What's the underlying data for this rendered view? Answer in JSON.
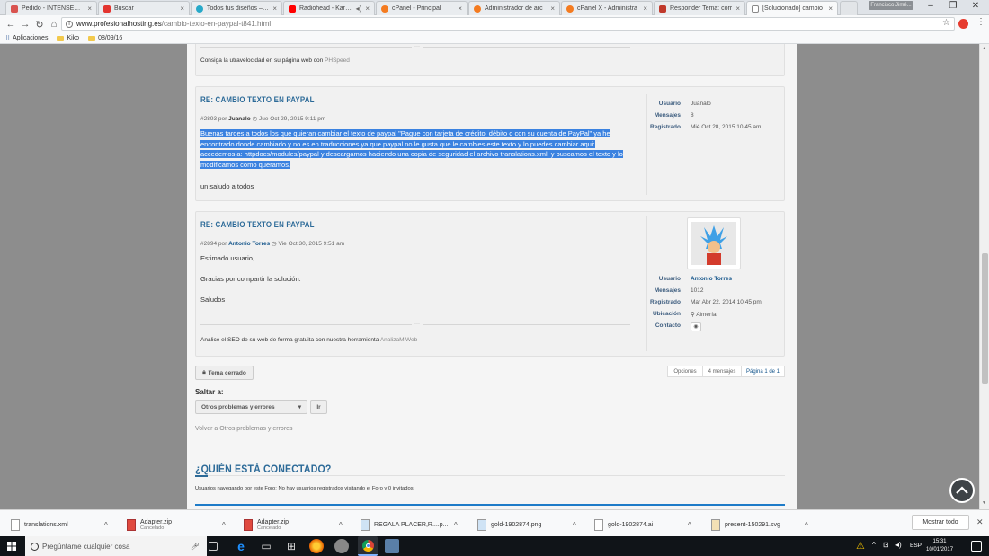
{
  "browser": {
    "tabs": [
      {
        "title": "Pedido - INTENSEX Ti",
        "color": "#d9534f"
      },
      {
        "title": "Buscar",
        "color": "#e3342f"
      },
      {
        "title": "Todos tus diseños – Ca",
        "color": "#27a9c9"
      },
      {
        "title": "Radiohead - Karma",
        "color": "#ff0000"
      },
      {
        "title": "cPanel - Principal",
        "color": "#f47b20"
      },
      {
        "title": "Administrador de arc",
        "color": "#f47b20"
      },
      {
        "title": "cPanel X - Administra",
        "color": "#f47b20"
      },
      {
        "title": "Responder Tema: corr",
        "color": "#c0392b"
      },
      {
        "title": "[Solucionado] cambio",
        "color": "#888888"
      }
    ],
    "profile_name": "Francisco Jimé...",
    "url_host": "www.profesionalhosting.es",
    "url_path": "/cambio-texto-en-paypal-t841.html",
    "bookmarks": [
      {
        "label": "Aplicaciones"
      },
      {
        "label": "Kiko"
      },
      {
        "label": "08/09/16"
      }
    ]
  },
  "page": {
    "top_signature": {
      "text": "Consiga la utravelocidad en su página web con ",
      "link": "PHSpeed"
    },
    "posts": [
      {
        "title": "RE: CAMBIO TEXTO EN PAYPAL",
        "number": "#2893",
        "by": "por",
        "author": "Juanalo",
        "date": "Jue Oct 29, 2015 9:11 pm",
        "body_highlighted": "Buenas tardes a todos los que quieran cambiar el texto de paypal \"Pague con tarjeta de crédito, débito o con su cuenta de PayPal\" ya he encontrado donde cambiarlo y no es en traducciones ya que paypal no le gusta que le cambies este texto y lo puedes cambiar aqui: accedemos a: httpdocs/modules/paypal y descargamos haciendo una copia de seguridad el archivo translations.xml. y buscamos el texto y lo modificamos como queramos.",
        "body_plain": "un saludo a todos",
        "profile": {
          "usuario_label": "Usuario",
          "usuario": "Juanalo",
          "mensajes_label": "Mensajes",
          "mensajes": "8",
          "registrado_label": "Registrado",
          "registrado": "Mié Oct 28, 2015 10:45 am"
        }
      },
      {
        "title": "RE: CAMBIO TEXTO EN PAYPAL",
        "number": "#2894",
        "by": "por",
        "author": "Antonio Torres",
        "date": "Vie Oct 30, 2015 9:51 am",
        "lines": [
          "Estimado usuario,",
          "Gracias por compartir la solución.",
          "Saludos"
        ],
        "signature_text": "Analice el SEO de su web de forma gratuita con nuestra herramienta ",
        "signature_link": "AnalizaMiWeb",
        "profile": {
          "usuario_label": "Usuario",
          "usuario": "Antonio Torres",
          "mensajes_label": "Mensajes",
          "mensajes": "1012",
          "registrado_label": "Registrado",
          "registrado": "Mar Abr 22, 2014 10:45 pm",
          "ubicacion_label": "Ubicación",
          "ubicacion": "Almería",
          "contacto_label": "Contacto"
        }
      }
    ],
    "topic_closed_label": "Tema cerrado",
    "options_label": "Opciones",
    "messages_count": "4 mensajes",
    "page_info": "Página 1 de 1",
    "jump_label": "Saltar a:",
    "jump_select": "Otros problemas y errores",
    "jump_go": "Ir",
    "back_link": "Volver a Otros problemas y errores",
    "who_online_title": "¿QUIÉN ESTÁ CONECTADO?",
    "who_online_text": "Usuarios navegando por este Foro: No hay usuarios registrados visitando el Foro y 0 invitados"
  },
  "downloads": {
    "items": [
      {
        "name": "translations.xml",
        "status": ""
      },
      {
        "name": "Adapter.zip",
        "status": "Cancelado"
      },
      {
        "name": "Adapter.zip",
        "status": "Cancelado"
      },
      {
        "name": "REGALA PLACER,R....p...",
        "status": ""
      },
      {
        "name": "gold-1902874.png",
        "status": ""
      },
      {
        "name": "gold-1902874.ai",
        "status": ""
      },
      {
        "name": "present-150291.svg",
        "status": ""
      }
    ],
    "show_all": "Mostrar todo"
  },
  "taskbar": {
    "search_placeholder": "Pregúntame cualquier cosa",
    "lang": "ESP",
    "time": "15:31",
    "date": "10/01/2017"
  }
}
